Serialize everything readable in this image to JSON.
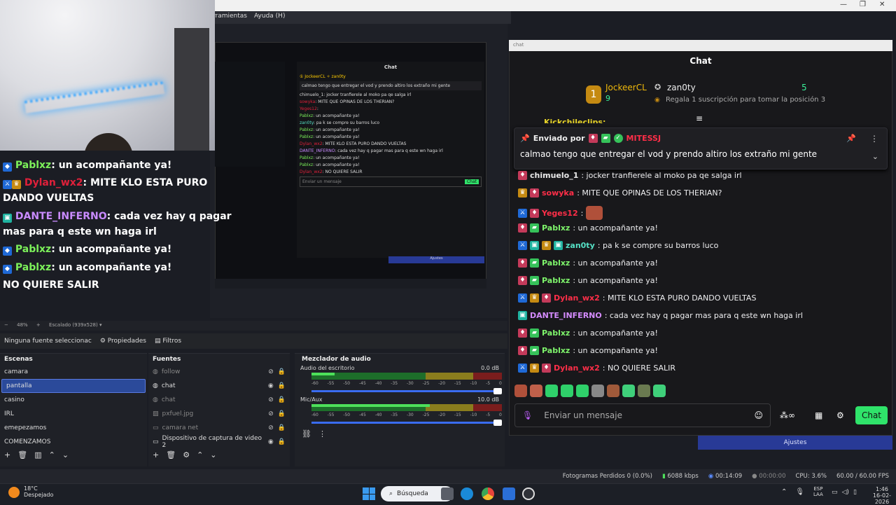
{
  "menubar": {
    "items": [
      "rramientas",
      "Ayuda (H)"
    ]
  },
  "window_controls": {
    "minimize": "—",
    "maximize": "❐",
    "close": "✕"
  },
  "overlay_lines": [
    {
      "user": "Pablxz",
      "text": ": un acompañante ya!"
    },
    {
      "user": "Dylan_wx2",
      "text": ": MITE KLO ESTA PURO"
    },
    {
      "cont": "DANDO VUELTAS"
    },
    {
      "user": "DANTE_INFERNO",
      "text": ": cada vez hay q pagar"
    },
    {
      "cont": "mas para q este wn haga irl"
    },
    {
      "user": "Pablxz",
      "text": ": un acompañante ya!"
    },
    {
      "user": "Pablxz",
      "text": ": un acompañante ya!"
    },
    {
      "cont": "NO QUIERE SALIR"
    }
  ],
  "zoombar": {
    "zoom": "48%",
    "scale": "Escalado (939x528)"
  },
  "propbar": {
    "no_source": "Ninguna fuente seleccionac",
    "properties": "Propiedades",
    "filters": "Filtros"
  },
  "scenes": {
    "title": "Escenas",
    "items": [
      "camara",
      "pantalla",
      "casino",
      "IRL",
      "emepezamos",
      "COMENZAMOS"
    ],
    "selected": 1
  },
  "sources": {
    "title": "Fuentes",
    "items": [
      {
        "label": "follow",
        "dim": true
      },
      {
        "label": "chat",
        "dim": false
      },
      {
        "label": "chat",
        "dim": true
      },
      {
        "label": "pxfuel.jpg",
        "dim": true
      },
      {
        "label": "camara net",
        "dim": true
      },
      {
        "label": "Dispositivo de captura de video 2",
        "dim": false
      }
    ]
  },
  "mixer": {
    "title": "Mezclador de audio",
    "channels": [
      {
        "name": "Audio del escritorio",
        "db": "0.0 dB",
        "level": 0.12
      },
      {
        "name": "Mic/Aux",
        "db": "10.0 dB",
        "level": 0.62
      }
    ],
    "ticks": [
      "-60",
      "-55",
      "-50",
      "-45",
      "-40",
      "-35",
      "-30",
      "-25",
      "-20",
      "-15",
      "-10",
      "-5",
      "0"
    ]
  },
  "chat": {
    "window_title": "chat",
    "header": "Chat",
    "leader": {
      "rank": "1",
      "name": "JockeerCL",
      "count1": "9",
      "name2": "zan0ty",
      "count2": "5",
      "subtext": "Regala 1 suscripción para tomar la posición 3"
    },
    "cut_name": "Kickchileclips:",
    "pinned": {
      "by": "Enviado por",
      "user": "MITESSJ",
      "text": "calmao tengo que entregar el vod y prendo altiro los extraño mi gente"
    },
    "messages": [
      {
        "user": "chimuelo_1",
        "text": ": jocker tranfierele al moko pa qe salga irl",
        "badges": [
          "mic"
        ],
        "color": "w"
      },
      {
        "user": "sowyka",
        "text": ": MITE QUE OPINAS DE LOS THERIAN?",
        "badges": [
          "gold",
          "mic"
        ],
        "color": "r"
      },
      {
        "user": "Yeges12",
        "text": ":",
        "badges": [
          "blue",
          "mic"
        ],
        "color": "r"
      },
      {
        "user": "Pablxz",
        "text": ": un acompañante ya!",
        "badges": [
          "mic",
          "green"
        ],
        "color": "g"
      },
      {
        "user": "zan0ty",
        "text": ": pa k se compre su barros luco",
        "badges": [
          "blue",
          "teal",
          "gold",
          "teal"
        ],
        "color": "y"
      },
      {
        "user": "Pablxz",
        "text": ": un acompañante ya!",
        "badges": [
          "mic",
          "green"
        ],
        "color": "g"
      },
      {
        "user": "Pablxz",
        "text": ": un acompañante ya!",
        "badges": [
          "mic",
          "green"
        ],
        "color": "g"
      },
      {
        "user": "Dylan_wx2",
        "text": ": MITE KLO ESTA PURO DANDO VUELTAS",
        "badges": [
          "blue",
          "gold",
          "mic"
        ],
        "color": "r"
      },
      {
        "user": "DANTE_INFERNO",
        "text": ": cada vez hay q pagar mas para q este wn haga irl",
        "badges": [
          "teal"
        ],
        "color": "p"
      },
      {
        "user": "Pablxz",
        "text": ": un acompañante ya!",
        "badges": [
          "mic",
          "green"
        ],
        "color": "g"
      },
      {
        "user": "Pablxz",
        "text": ": un acompañante ya!",
        "badges": [
          "mic",
          "green"
        ],
        "color": "g"
      },
      {
        "user": "Dylan_wx2",
        "text": ": NO QUIERE SALIR",
        "badges": [
          "blue",
          "gold",
          "mic"
        ],
        "color": "r"
      }
    ],
    "input_placeholder": "Enviar un mensaje",
    "send_label": "Chat",
    "ajustes": "Ajustes"
  },
  "mini_chat": {
    "header": "Chat",
    "send": "Chat",
    "placeholder": "Enviar un mensaje",
    "ajustes": "Ajustes"
  },
  "statusbar": {
    "dropped": "Fotogramas Perdidos 0 (0.0%)",
    "kbps": "6088 kbps",
    "stream_time": "00:14:09",
    "rec_time": "00:00:00",
    "cpu": "CPU: 3.6%",
    "fps": "60.00 / 60.00 FPS"
  },
  "taskbar": {
    "temp": "18°C",
    "weather": "Despejado",
    "search": "Búsqueda",
    "lang1": "ESP",
    "lang2": "LAA",
    "time": "1:46",
    "date": "16-02-2026"
  },
  "colors": {
    "accent": "#2fe36a",
    "selection": "#2b4a9a",
    "chat_bg": "#18181b"
  }
}
